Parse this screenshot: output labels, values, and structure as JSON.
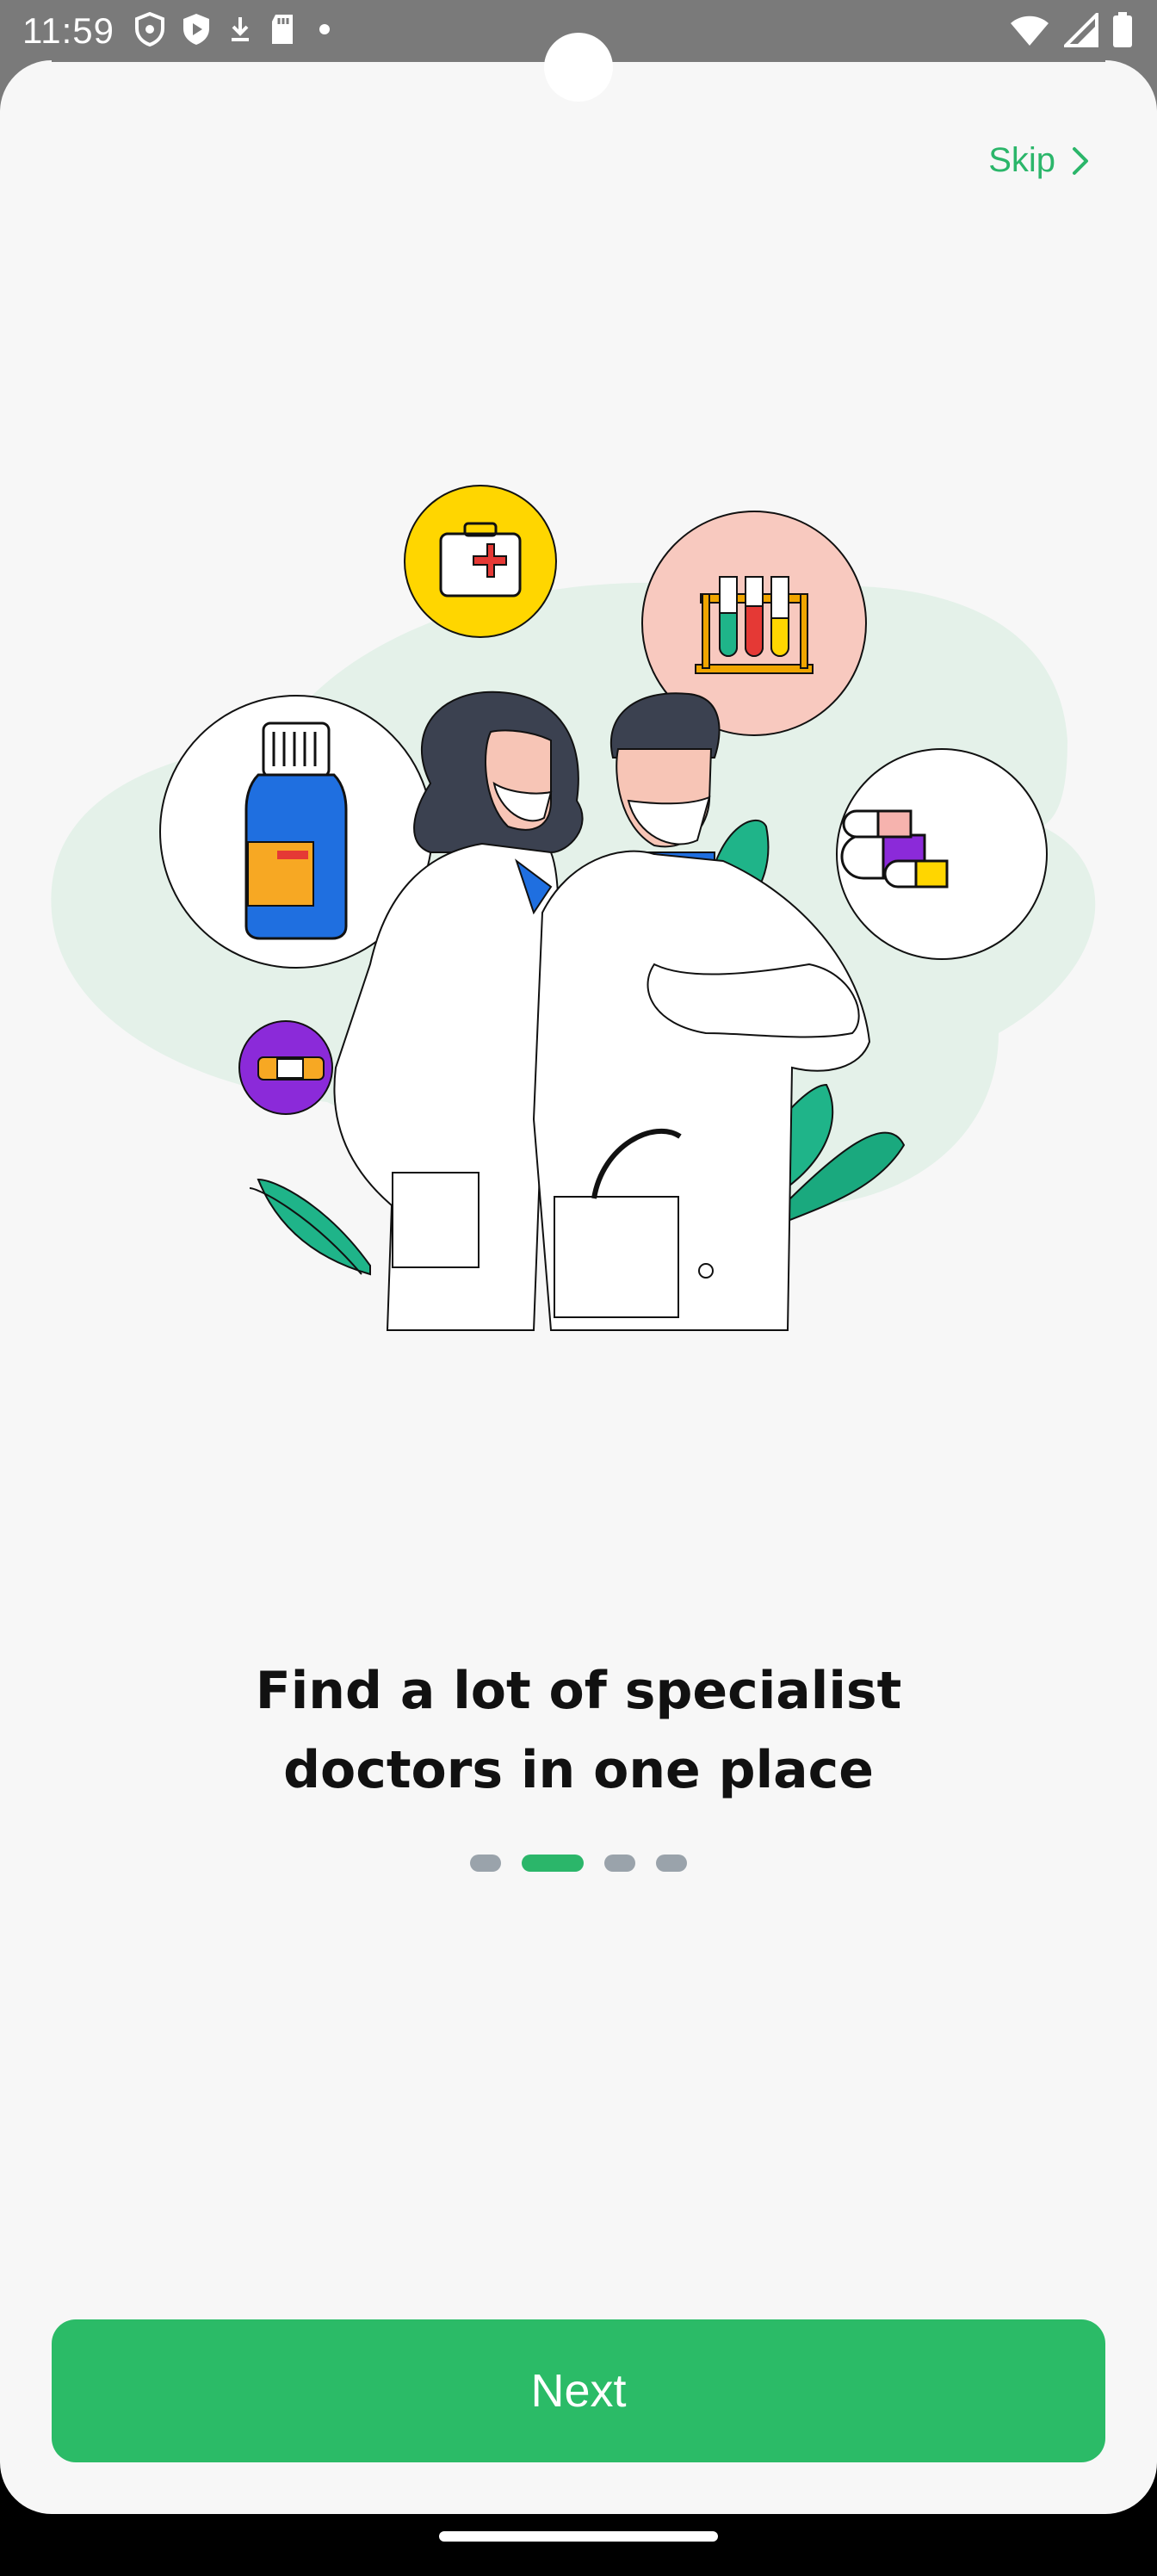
{
  "status_bar": {
    "time": "11:59",
    "left_icons": [
      "shield-icon",
      "play-shield-icon",
      "download-icon",
      "sd-card-icon",
      "dot-icon"
    ],
    "right_icons": [
      "wifi-icon",
      "signal-icon",
      "battery-icon"
    ]
  },
  "header": {
    "skip_label": "Skip"
  },
  "onboarding": {
    "illustration": "doctors-illustration",
    "headline_line1": "Find a lot of specialist",
    "headline_line2": "doctors in one place",
    "page_count": 4,
    "current_page": 2
  },
  "footer": {
    "next_label": "Next"
  },
  "colors": {
    "accent": "#2BBB67",
    "background": "#F7F7F7",
    "dot_inactive": "#9AA3AB"
  }
}
